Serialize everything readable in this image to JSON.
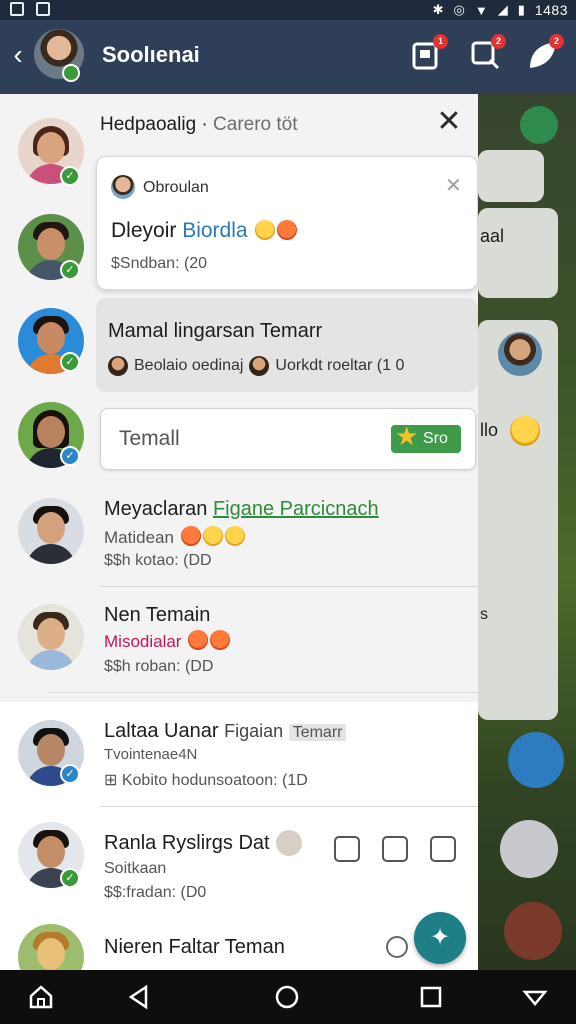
{
  "status_bar": {
    "time": "1483"
  },
  "app_bar": {
    "title": "Soolıenai",
    "notif_badges": [
      "1",
      "2",
      "2"
    ]
  },
  "panel": {
    "header_title": "Hedpaoalig ·",
    "header_subtitle": "Carero töt",
    "popup": {
      "name": "Obroulan",
      "message_prefix": "Dleyoir",
      "message_highlight": "Biordla",
      "meta": "$Sndban: (20"
    },
    "card2": {
      "line1": "Mamal lingarsan Temarr",
      "line2_a": "Beolaio oedinaj",
      "line2_b": "Uorkdt roeltar (1 0"
    },
    "input": {
      "value": "Temall",
      "send_label": "Sro"
    },
    "rows": [
      {
        "name": "Meyaclaran",
        "name_tag": "Figane Parcicnach",
        "sub": "Matidean",
        "meta": "$$h kotao: (DD"
      },
      {
        "name": "Nen Temain",
        "sub": "Misodialar",
        "meta": "$$h roban: (DD"
      },
      {
        "name": "Laltaa Uanar",
        "name_extra": "Figaian",
        "name_tag": "Temarr",
        "sub": "Tvointenae4N",
        "meta": "Kobito hodunsoatoon: (1D"
      },
      {
        "name": "Ranla Ryslirgs Dat",
        "sub": "Soitkaan",
        "meta": "$$:fradan: (D0"
      },
      {
        "name": "Nieren Faltar Teman"
      }
    ]
  },
  "background": {
    "card_text_1": "aal",
    "card_text_2": "llo",
    "card_text_3": "s"
  },
  "colors": {
    "app_bar": "#2e3f57",
    "accent_green": "#3d9b4a",
    "fab": "#1e7f86",
    "status_online": "#3a9a3a",
    "status_blue": "#2b86c9"
  }
}
